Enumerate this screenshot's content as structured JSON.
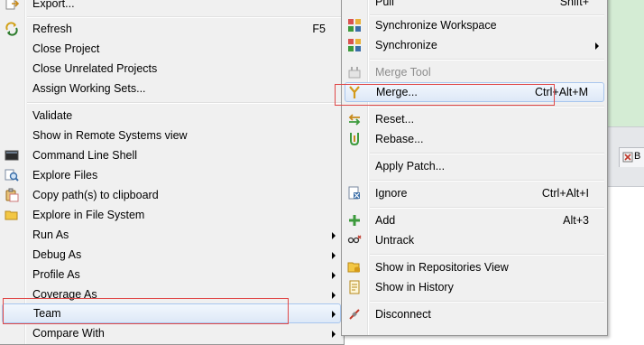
{
  "context_menu": {
    "items": [
      {
        "label": "Export...",
        "icon": "export-icon"
      },
      {
        "label": "Refresh",
        "accel": "F5",
        "icon": "refresh-icon"
      },
      {
        "label": "Close Project"
      },
      {
        "label": "Close Unrelated Projects"
      },
      {
        "label": "Assign Working Sets..."
      },
      {
        "label": "Validate"
      },
      {
        "label": "Show in Remote Systems view"
      },
      {
        "label": "Command Line Shell",
        "icon": "terminal-icon"
      },
      {
        "label": "Explore Files",
        "icon": "explore-files-icon"
      },
      {
        "label": "Copy path(s) to clipboard",
        "icon": "copy-path-icon"
      },
      {
        "label": "Explore in File System",
        "icon": "folder-icon"
      },
      {
        "label": "Run As",
        "submenu": true
      },
      {
        "label": "Debug As",
        "submenu": true
      },
      {
        "label": "Profile As",
        "submenu": true
      },
      {
        "label": "Coverage As",
        "submenu": true
      },
      {
        "label": "Team",
        "submenu": true,
        "highlighted": true
      },
      {
        "label": "Compare With",
        "submenu": true
      }
    ]
  },
  "team_menu": {
    "items": [
      {
        "label": "Pull",
        "accel": "Shift+"
      },
      {
        "label": "Synchronize Workspace",
        "icon": "synchronize-workspace-icon"
      },
      {
        "label": "Synchronize",
        "icon": "synchronize-icon",
        "submenu": true
      },
      {
        "label": "Merge Tool",
        "icon": "merge-tool-icon",
        "disabled": true
      },
      {
        "label": "Merge...",
        "accel": "Ctrl+Alt+M",
        "icon": "merge-icon",
        "highlighted": true
      },
      {
        "label": "Reset...",
        "icon": "reset-icon"
      },
      {
        "label": "Rebase...",
        "icon": "rebase-icon"
      },
      {
        "label": "Apply Patch..."
      },
      {
        "label": "Ignore",
        "accel": "Ctrl+Alt+I",
        "icon": "ignore-icon"
      },
      {
        "label": "Add",
        "accel": "Alt+3",
        "icon": "add-icon"
      },
      {
        "label": "Untrack",
        "icon": "untrack-icon"
      },
      {
        "label": "Show in Repositories View",
        "icon": "repositories-view-icon"
      },
      {
        "label": "Show in History",
        "icon": "history-icon"
      },
      {
        "label": "Disconnect",
        "icon": "disconnect-icon"
      }
    ]
  },
  "background": {
    "tab_label": "B",
    "colors": {
      "editor": "#d4ecd4",
      "highlight_border": "#a8c6ee",
      "annotation": "#e04848"
    }
  }
}
